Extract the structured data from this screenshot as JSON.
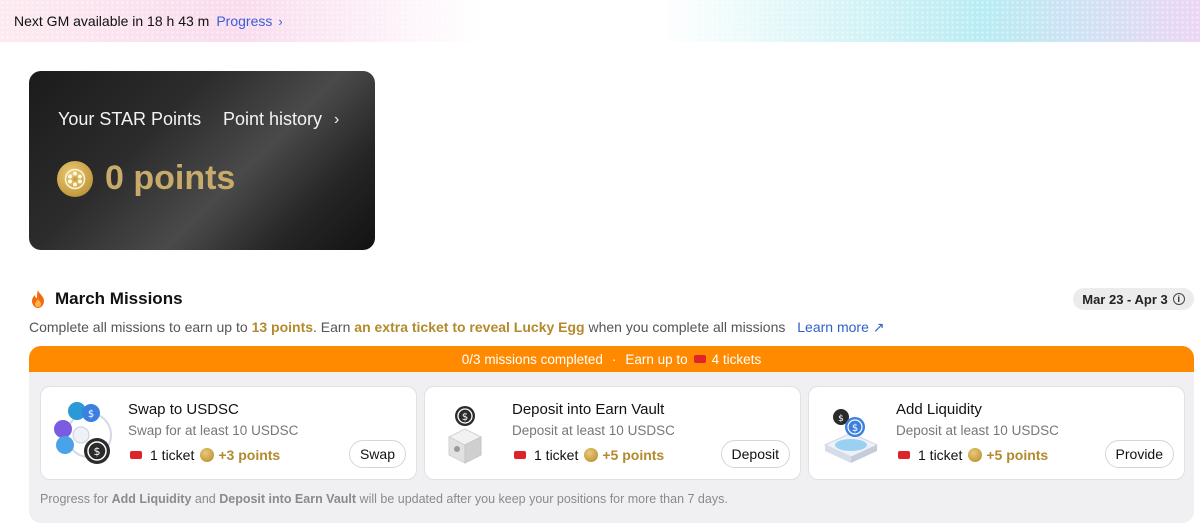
{
  "banner": {
    "gm_text": "Next GM available in 18 h 43 m",
    "progress_link": "Progress",
    "chevron": "›"
  },
  "points_card": {
    "title": "Your STAR Points",
    "history_label": "Point history",
    "chevron": "›",
    "points_value": "0 points"
  },
  "missions": {
    "title": "March Missions",
    "date_range": "Mar 23 - Apr 3",
    "info_glyph": "i",
    "desc_prefix": "Complete all missions to earn up to ",
    "desc_points": "13 points",
    "desc_mid": ". Earn ",
    "desc_ticket_text": "an extra ticket to reveal Lucky Egg",
    "desc_suffix": " when you complete all missions",
    "learn_more": "Learn more ↗",
    "progress_completed": "0/3 missions completed",
    "progress_sep": "·",
    "progress_earn": "Earn up to",
    "progress_tickets": "4 tickets",
    "cards": [
      {
        "title": "Swap to USDSC",
        "subtitle": "Swap for at least 10 USDSC",
        "ticket": "1 ticket",
        "points": "+3 points",
        "button": "Swap"
      },
      {
        "title": "Deposit into Earn Vault",
        "subtitle": "Deposit at least 10 USDSC",
        "ticket": "1 ticket",
        "points": "+5 points",
        "button": "Deposit"
      },
      {
        "title": "Add Liquidity",
        "subtitle": "Deposit at least 10 USDSC",
        "ticket": "1 ticket",
        "points": "+5 points",
        "button": "Provide"
      }
    ],
    "note_prefix": "Progress for ",
    "note_a": "Add Liquidity",
    "note_and": " and ",
    "note_b": "Deposit into Earn Vault",
    "note_suffix": " will be updated after you keep your positions for more than 7 days."
  },
  "colors": {
    "accent_orange": "#ff8a00",
    "gold": "#b38a2d",
    "link_blue": "#2f5fcc",
    "ticket_red": "#e0222a"
  },
  "icons": {
    "fire": "fire-icon",
    "coin": "star-coin-icon",
    "ticket": "ticket-icon",
    "info": "info-icon",
    "chevron": "chevron-right-icon"
  }
}
